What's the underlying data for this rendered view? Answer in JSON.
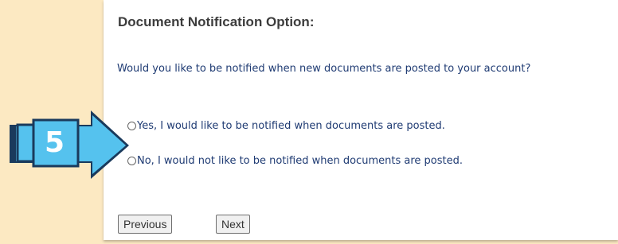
{
  "form": {
    "heading": "Document Notification Option:",
    "question": "Would you like to be notified when new documents are posted to your account?",
    "options": [
      {
        "label": "Yes, I would like to be notified when documents are posted.",
        "selected": false
      },
      {
        "label": "No, I would not like to be notified when documents are posted.",
        "selected": false
      }
    ],
    "buttons": {
      "previous": "Previous",
      "next": "Next"
    }
  },
  "callout": {
    "step": "5",
    "colors": {
      "fill": "#55c2ee",
      "border": "#1a3a5c"
    }
  }
}
